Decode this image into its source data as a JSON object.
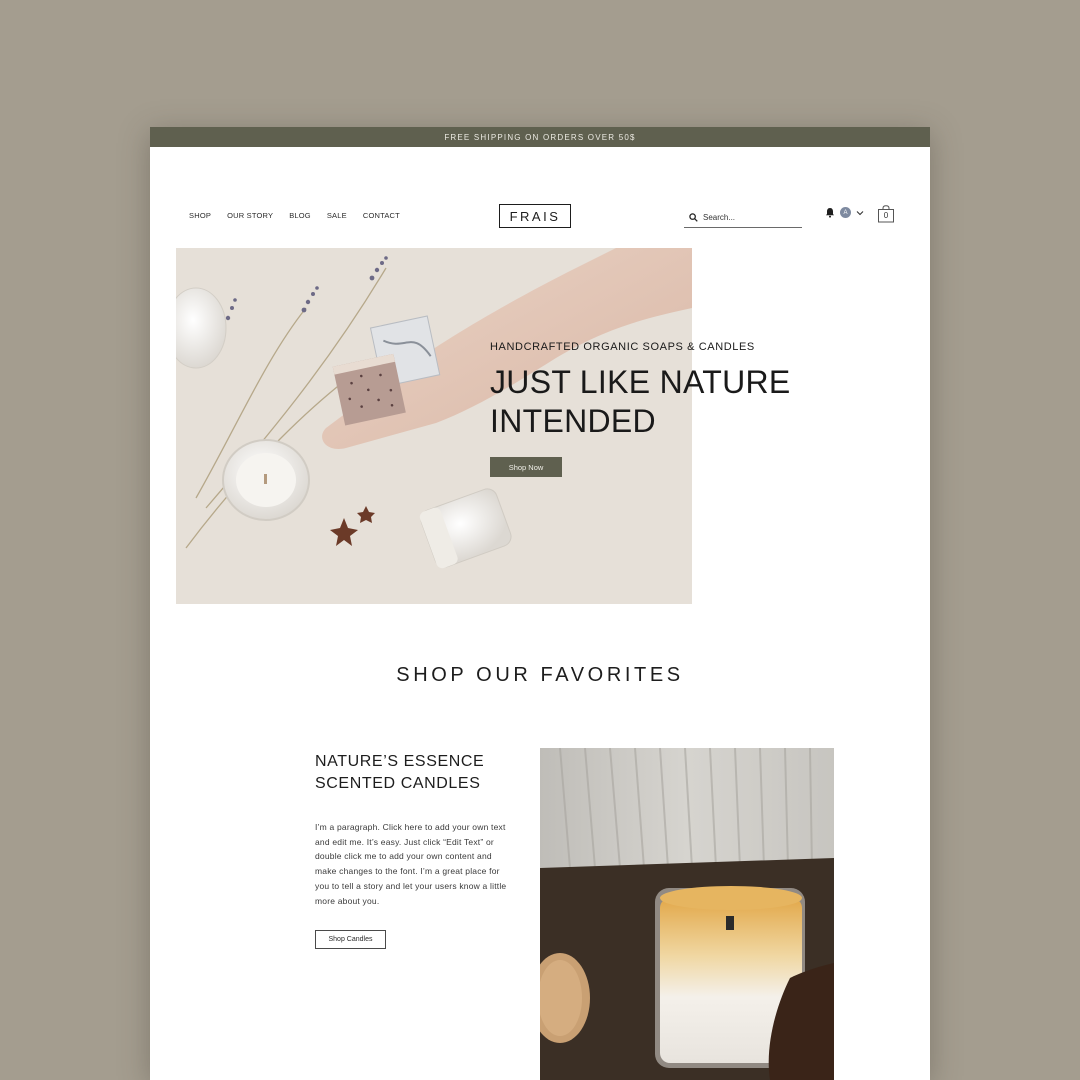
{
  "announcement": "FREE SHIPPING ON ORDERS OVER 50$",
  "nav": {
    "items": [
      "SHOP",
      "OUR STORY",
      "BLOG",
      "SALE",
      "CONTACT"
    ]
  },
  "logo": "FRAIS",
  "search": {
    "placeholder": "Search..."
  },
  "account": {
    "avatar_letter": "A"
  },
  "cart": {
    "count": "0"
  },
  "hero": {
    "subtitle": "HANDCRAFTED ORGANIC SOAPS & CANDLES",
    "title_line1": "JUST LIKE NATURE",
    "title_line2": "INTENDED",
    "button": "Shop Now"
  },
  "favorites": {
    "title": "SHOP OUR FAVORITES",
    "collection_title_line1": "NATURE’S ESSENCE",
    "collection_title_line2": "SCENTED CANDLES",
    "paragraph": "I’m a paragraph. Click here to add your own text and edit me. It’s easy. Just click “Edit Text” or double click me to add your own content and make changes to the font. I’m a great place for you to tell a story and let your users know a little more about you.",
    "button": "Shop Candles"
  },
  "colors": {
    "accent": "#5f604f",
    "page_background": "#a49d8f",
    "card_background": "#ffffff"
  },
  "icons": [
    "search-icon",
    "bell-icon",
    "chevron-down-icon",
    "shopping-bag-icon"
  ]
}
